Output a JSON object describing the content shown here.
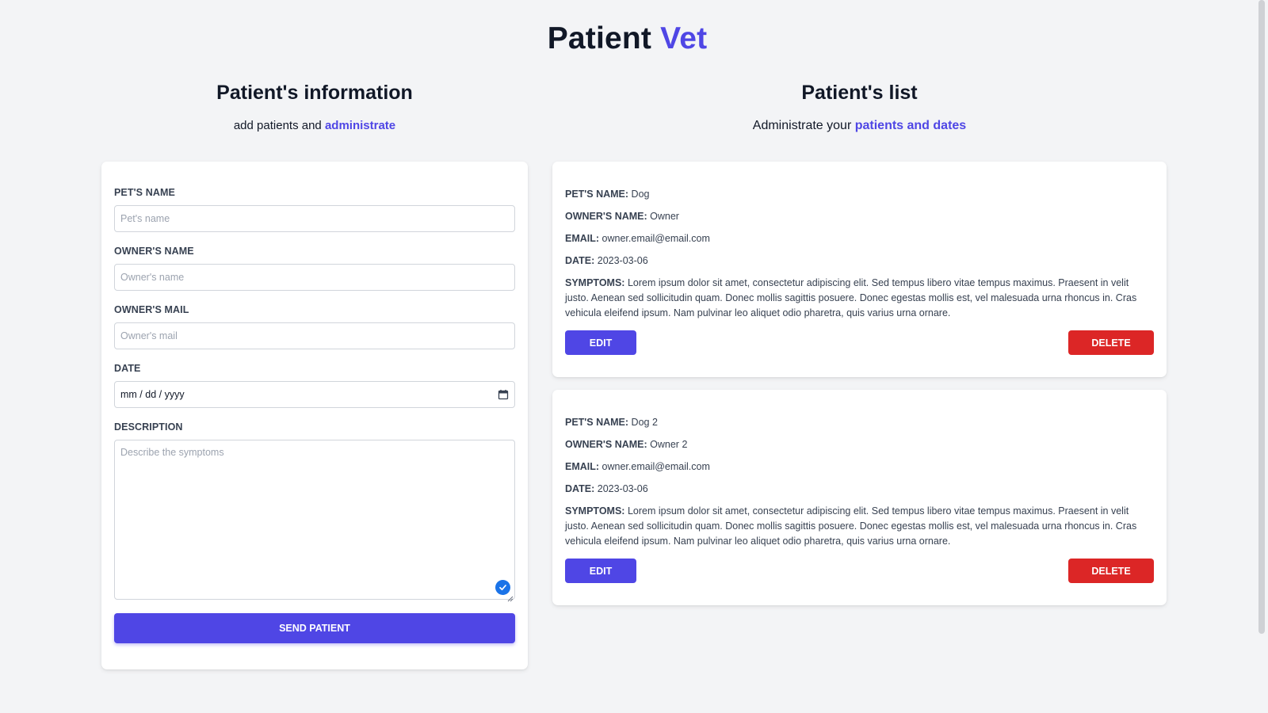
{
  "app": {
    "title_main": "Patient",
    "title_accent": "Vet"
  },
  "colors": {
    "accent": "#4f46e5",
    "danger": "#dc2626",
    "background": "#f3f4f6"
  },
  "form_section": {
    "heading": "Patient's information",
    "subtitle_prefix": "add patients and ",
    "subtitle_accent": "administrate"
  },
  "list_section": {
    "heading": "Patient's list",
    "subtitle_prefix": "Administrate your ",
    "subtitle_accent": "patients and dates"
  },
  "form": {
    "pet_name": {
      "label": "Pet's name",
      "placeholder": "Pet's name",
      "value": ""
    },
    "owner_name": {
      "label": "Owner's name",
      "placeholder": "Owner's name",
      "value": ""
    },
    "owner_mail": {
      "label": "Owner's mail",
      "placeholder": "Owner's mail",
      "value": ""
    },
    "date": {
      "label": "Date",
      "value": "mm / dd / yyyy",
      "icon": "calendar-icon"
    },
    "description": {
      "label": "Description",
      "placeholder": "Describe the symptoms",
      "value": ""
    },
    "submit_label": "Send patient"
  },
  "patients": [
    {
      "pet_label": "Pet's name:",
      "pet": "Dog",
      "owner_label": "Owner's name:",
      "owner": "Owner",
      "email_label": "Email:",
      "email": "owner.email@email.com",
      "date_label": "Date:",
      "date": "2023-03-06",
      "symptoms_label": "Symptoms:",
      "symptoms": "Lorem ipsum dolor sit amet, consectetur adipiscing elit. Sed tempus libero vitae tempus maximus. Praesent in velit justo. Aenean sed sollicitudin quam. Donec mollis sagittis posuere. Donec egestas mollis est, vel malesuada urna rhoncus in. Cras vehicula eleifend ipsum. Nam pulvinar leo aliquet odio pharetra, quis varius urna ornare.",
      "edit_label": "Edit",
      "delete_label": "Delete"
    },
    {
      "pet_label": "Pet's name:",
      "pet": "Dog 2",
      "owner_label": "Owner's name:",
      "owner": "Owner 2",
      "email_label": "Email:",
      "email": "owner.email@email.com",
      "date_label": "Date:",
      "date": "2023-03-06",
      "symptoms_label": "Symptoms:",
      "symptoms": "Lorem ipsum dolor sit amet, consectetur adipiscing elit. Sed tempus libero vitae tempus maximus. Praesent in velit justo. Aenean sed sollicitudin quam. Donec mollis sagittis posuere. Donec egestas mollis est, vel malesuada urna rhoncus in. Cras vehicula eleifend ipsum. Nam pulvinar leo aliquet odio pharetra, quis varius urna ornare.",
      "edit_label": "Edit",
      "delete_label": "Delete"
    }
  ]
}
